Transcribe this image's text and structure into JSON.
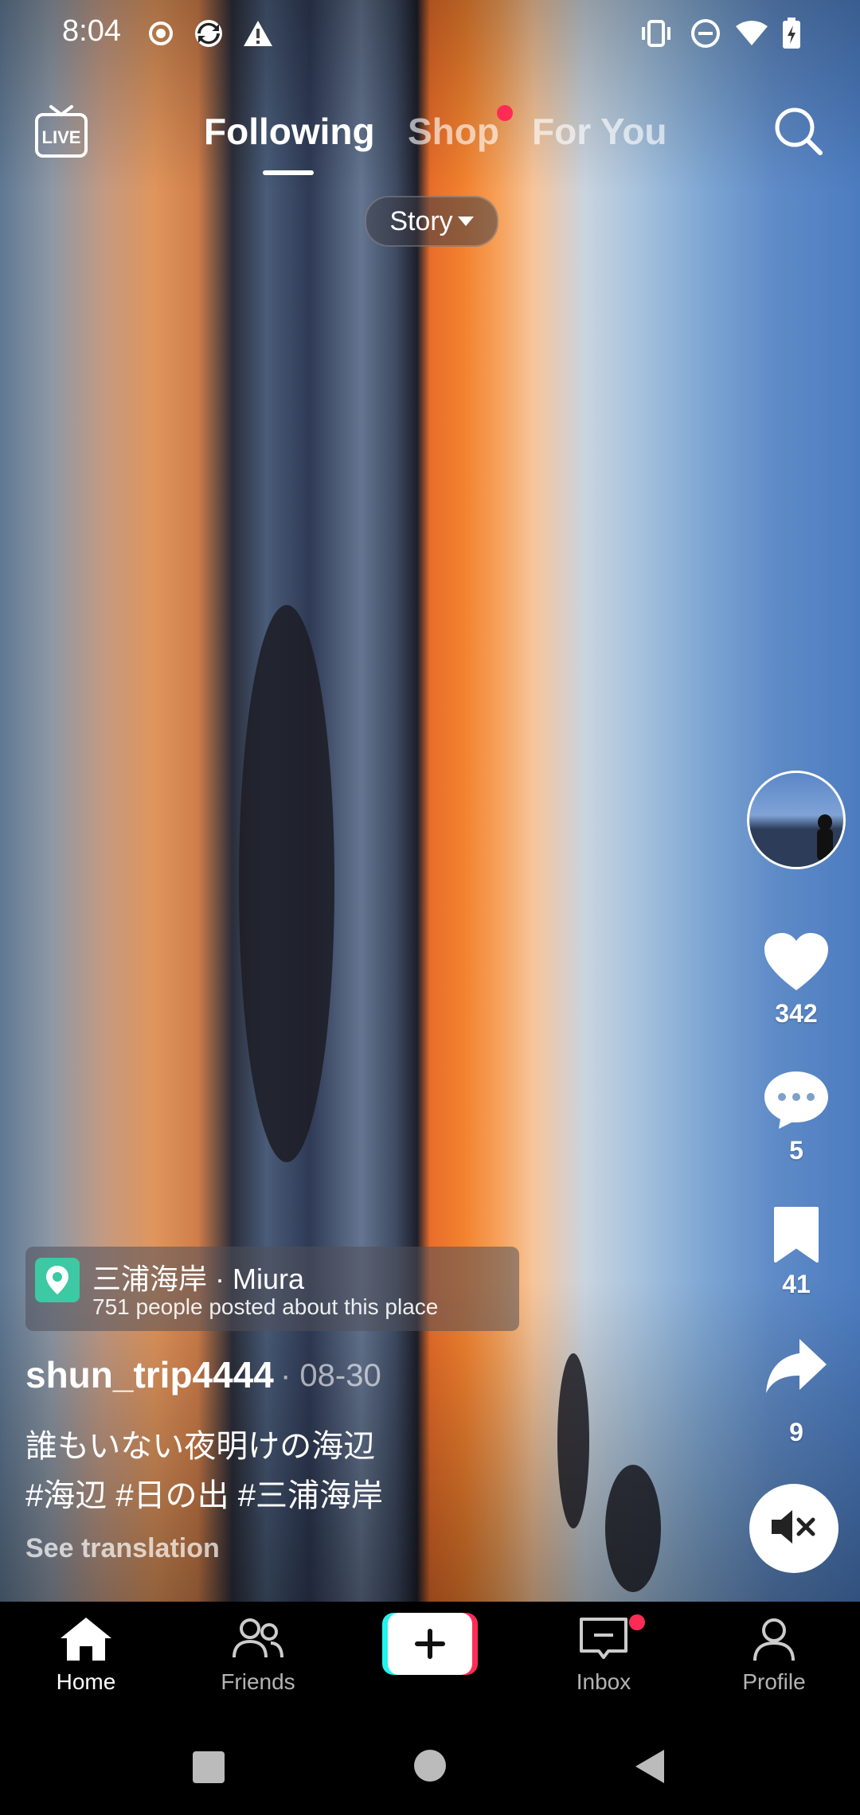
{
  "status_bar": {
    "time": "8:04",
    "left_icons": [
      "record-icon",
      "sync-app-icon",
      "warning-icon"
    ],
    "right_icons": [
      "vibrate-icon",
      "dnd-icon",
      "wifi-icon",
      "battery-charging-icon"
    ]
  },
  "top_nav": {
    "live_icon": "live-tv-icon",
    "tabs": [
      {
        "label": "Following",
        "active": true
      },
      {
        "label": "Shop",
        "active": false,
        "badge": true
      },
      {
        "label": "For You",
        "active": false
      }
    ],
    "search_icon": "search-icon"
  },
  "story_chip": {
    "label": "Story"
  },
  "actions": {
    "likes": "342",
    "comments": "5",
    "saves": "41",
    "shares": "9"
  },
  "location": {
    "name": "三浦海岸 · Miura",
    "subtitle": "751 people posted about this place"
  },
  "post": {
    "username": "shun_trip4444",
    "date": "· 08-30",
    "caption_line1": "誰もいない夜明けの海辺",
    "caption_line2": "#海辺 #日の出 #三浦海岸",
    "see_translation": "See translation"
  },
  "bottom_nav": {
    "home": "Home",
    "friends": "Friends",
    "inbox": "Inbox",
    "profile": "Profile"
  },
  "colors": {
    "accent_red": "#fe2c55",
    "accent_cyan": "#25f4ee",
    "location_pin": "#3cc9a3"
  }
}
